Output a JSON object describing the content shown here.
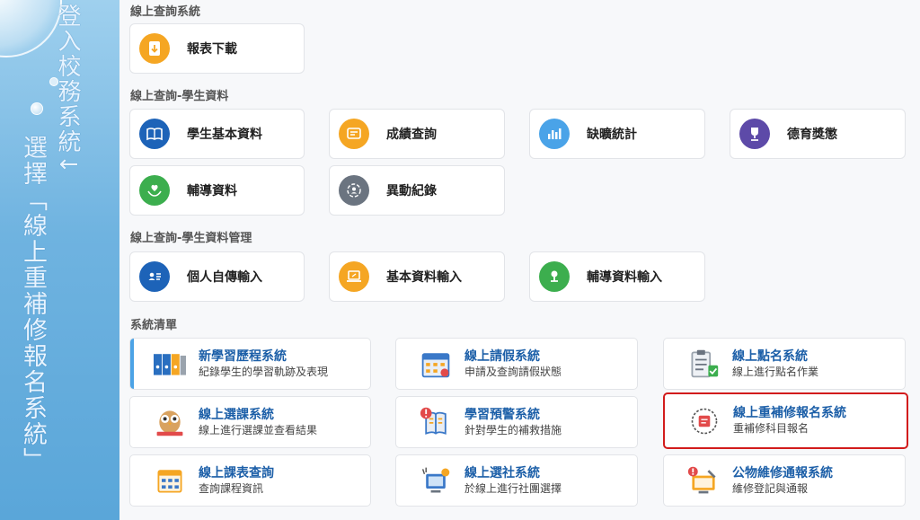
{
  "left_panel": {
    "login_text": "登入校務系統↓",
    "select_text": "選擇「線上重補修報名系統」"
  },
  "sections": {
    "query": "線上查詢系統",
    "student_data": "線上查詢-學生資料",
    "student_data_mgmt": "線上查詢-學生資料管理",
    "system_list": "系統清單"
  },
  "cards": {
    "report_download": "報表下載",
    "student_basic": "學生基本資料",
    "grade_query": "成績查詢",
    "absence_stats": "缺曠統計",
    "moral_awards": "德育獎懲",
    "counseling": "輔導資料",
    "change_records": "異動紀錄",
    "autobiography_input": "個人自傳輸入",
    "basic_input": "基本資料輸入",
    "counseling_input": "輔導資料輸入"
  },
  "systems": [
    {
      "name": "新學習歷程系統",
      "desc": "紀錄學生的學習軌跡及表現",
      "icon": "binders-icon"
    },
    {
      "name": "線上請假系統",
      "desc": "申請及查詢請假狀態",
      "icon": "calendar-icon"
    },
    {
      "name": "線上點名系統",
      "desc": "線上進行點名作業",
      "icon": "clipboard-icon"
    },
    {
      "name": "線上選課系統",
      "desc": "線上進行選課並查看結果",
      "icon": "owl-icon"
    },
    {
      "name": "學習預警系統",
      "desc": "針對學生的補救措施",
      "icon": "warning-book-icon"
    },
    {
      "name": "線上重補修報名系統",
      "desc": "重補修科目報名",
      "icon": "retake-icon"
    },
    {
      "name": "線上課表查詢",
      "desc": "查詢課程資訊",
      "icon": "timetable-icon"
    },
    {
      "name": "線上選社系統",
      "desc": "於線上進行社團選擇",
      "icon": "club-icon"
    },
    {
      "name": "公物維修通報系統",
      "desc": "維修登記與通報",
      "icon": "repair-icon"
    }
  ],
  "colors": {
    "orange": "#f5a623",
    "blue": "#1d63b8",
    "light_blue": "#4aa3e8",
    "purple": "#5d4aa8",
    "green": "#3cae4e",
    "gray": "#6b7480",
    "highlight": "#d21c1c"
  }
}
